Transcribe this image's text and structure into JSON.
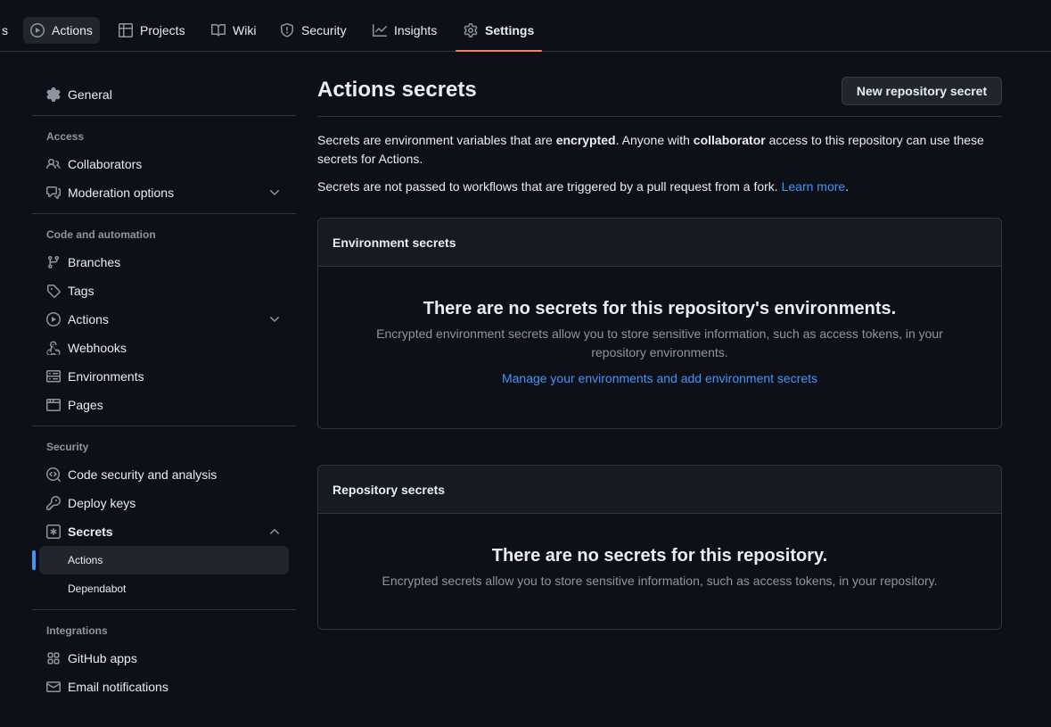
{
  "topnav": {
    "tabs": [
      {
        "label": "s"
      },
      {
        "label": "Actions"
      },
      {
        "label": "Projects"
      },
      {
        "label": "Wiki"
      },
      {
        "label": "Security"
      },
      {
        "label": "Insights"
      },
      {
        "label": "Settings"
      }
    ]
  },
  "sidebar": {
    "general": "General",
    "access": {
      "heading": "Access",
      "collaborators": "Collaborators",
      "moderation": "Moderation options"
    },
    "code": {
      "heading": "Code and automation",
      "branches": "Branches",
      "tags": "Tags",
      "actions": "Actions",
      "webhooks": "Webhooks",
      "environments": "Environments",
      "pages": "Pages"
    },
    "security": {
      "heading": "Security",
      "code_security": "Code security and analysis",
      "deploy_keys": "Deploy keys",
      "secrets": "Secrets",
      "secrets_actions": "Actions",
      "secrets_dependabot": "Dependabot"
    },
    "integrations": {
      "heading": "Integrations",
      "github_apps": "GitHub apps",
      "email_notifications": "Email notifications"
    }
  },
  "main": {
    "title": "Actions secrets",
    "new_button": "New repository secret",
    "intro": {
      "p1_a": "Secrets are environment variables that are ",
      "p1_b": "encrypted",
      "p1_c": ". Anyone with ",
      "p1_d": "collaborator",
      "p1_e": " access to this repository can use these secrets for Actions.",
      "p2": "Secrets are not passed to workflows that are triggered by a pull request from a fork. ",
      "learn_more": "Learn more",
      "p2_end": "."
    },
    "env_box": {
      "header": "Environment secrets",
      "blank_title": "There are no secrets for this repository's environments.",
      "blank_text": "Encrypted environment secrets allow you to store sensitive information, such as access tokens, in your repository environments.",
      "link": "Manage your environments and add environment secrets"
    },
    "repo_box": {
      "header": "Repository secrets",
      "blank_title": "There are no secrets for this repository.",
      "blank_text": "Encrypted secrets allow you to store sensitive information, such as access tokens, in your repository."
    }
  },
  "colors": {
    "background": "#0d1117",
    "accent_underline": "#f78166",
    "link": "#4493f8",
    "border": "#30363d"
  }
}
